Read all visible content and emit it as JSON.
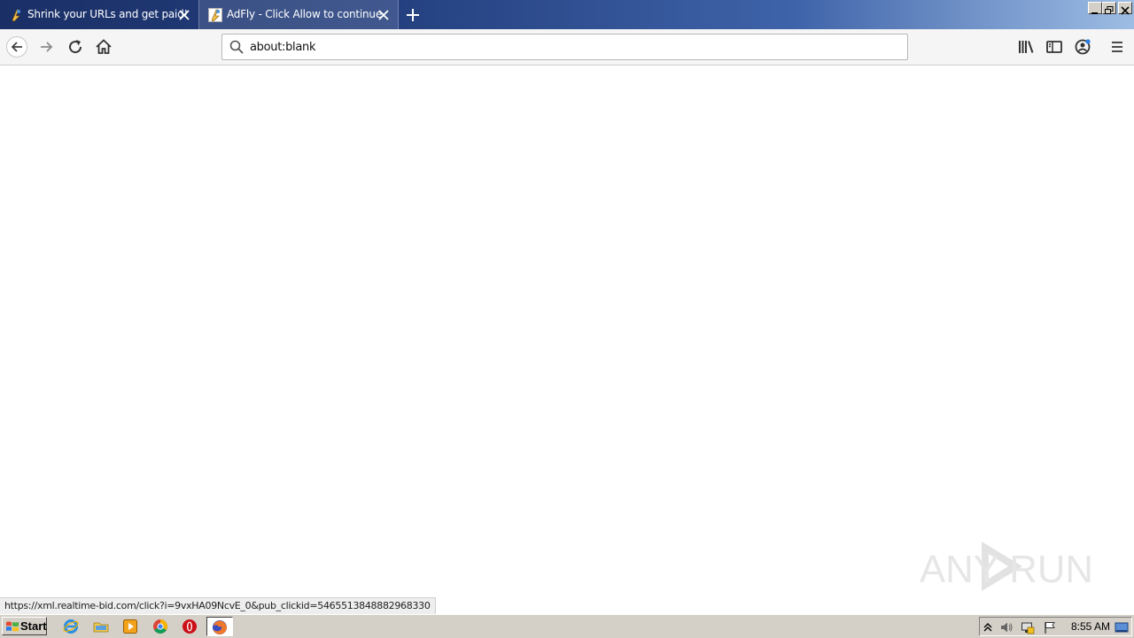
{
  "browser": {
    "tabs": [
      {
        "title": "Shrink your URLs and get paid!",
        "active": false
      },
      {
        "title": "AdFly - Click Allow to continue",
        "active": true
      }
    ],
    "address": {
      "value": "about:blank"
    }
  },
  "status_bar": {
    "link": "https://xml.realtime-bid.com/click?i=9vxHA09NcvE_0&pub_clickid=5465513848882968330"
  },
  "watermark": {
    "text": "ANY RUN"
  },
  "taskbar": {
    "start_label": "Start",
    "clock": "8:55 AM"
  },
  "colors": {
    "titlebar_dark": "#1a2f66",
    "titlebar_light": "#9dbde4",
    "taskbar": "#d4d0c8"
  }
}
